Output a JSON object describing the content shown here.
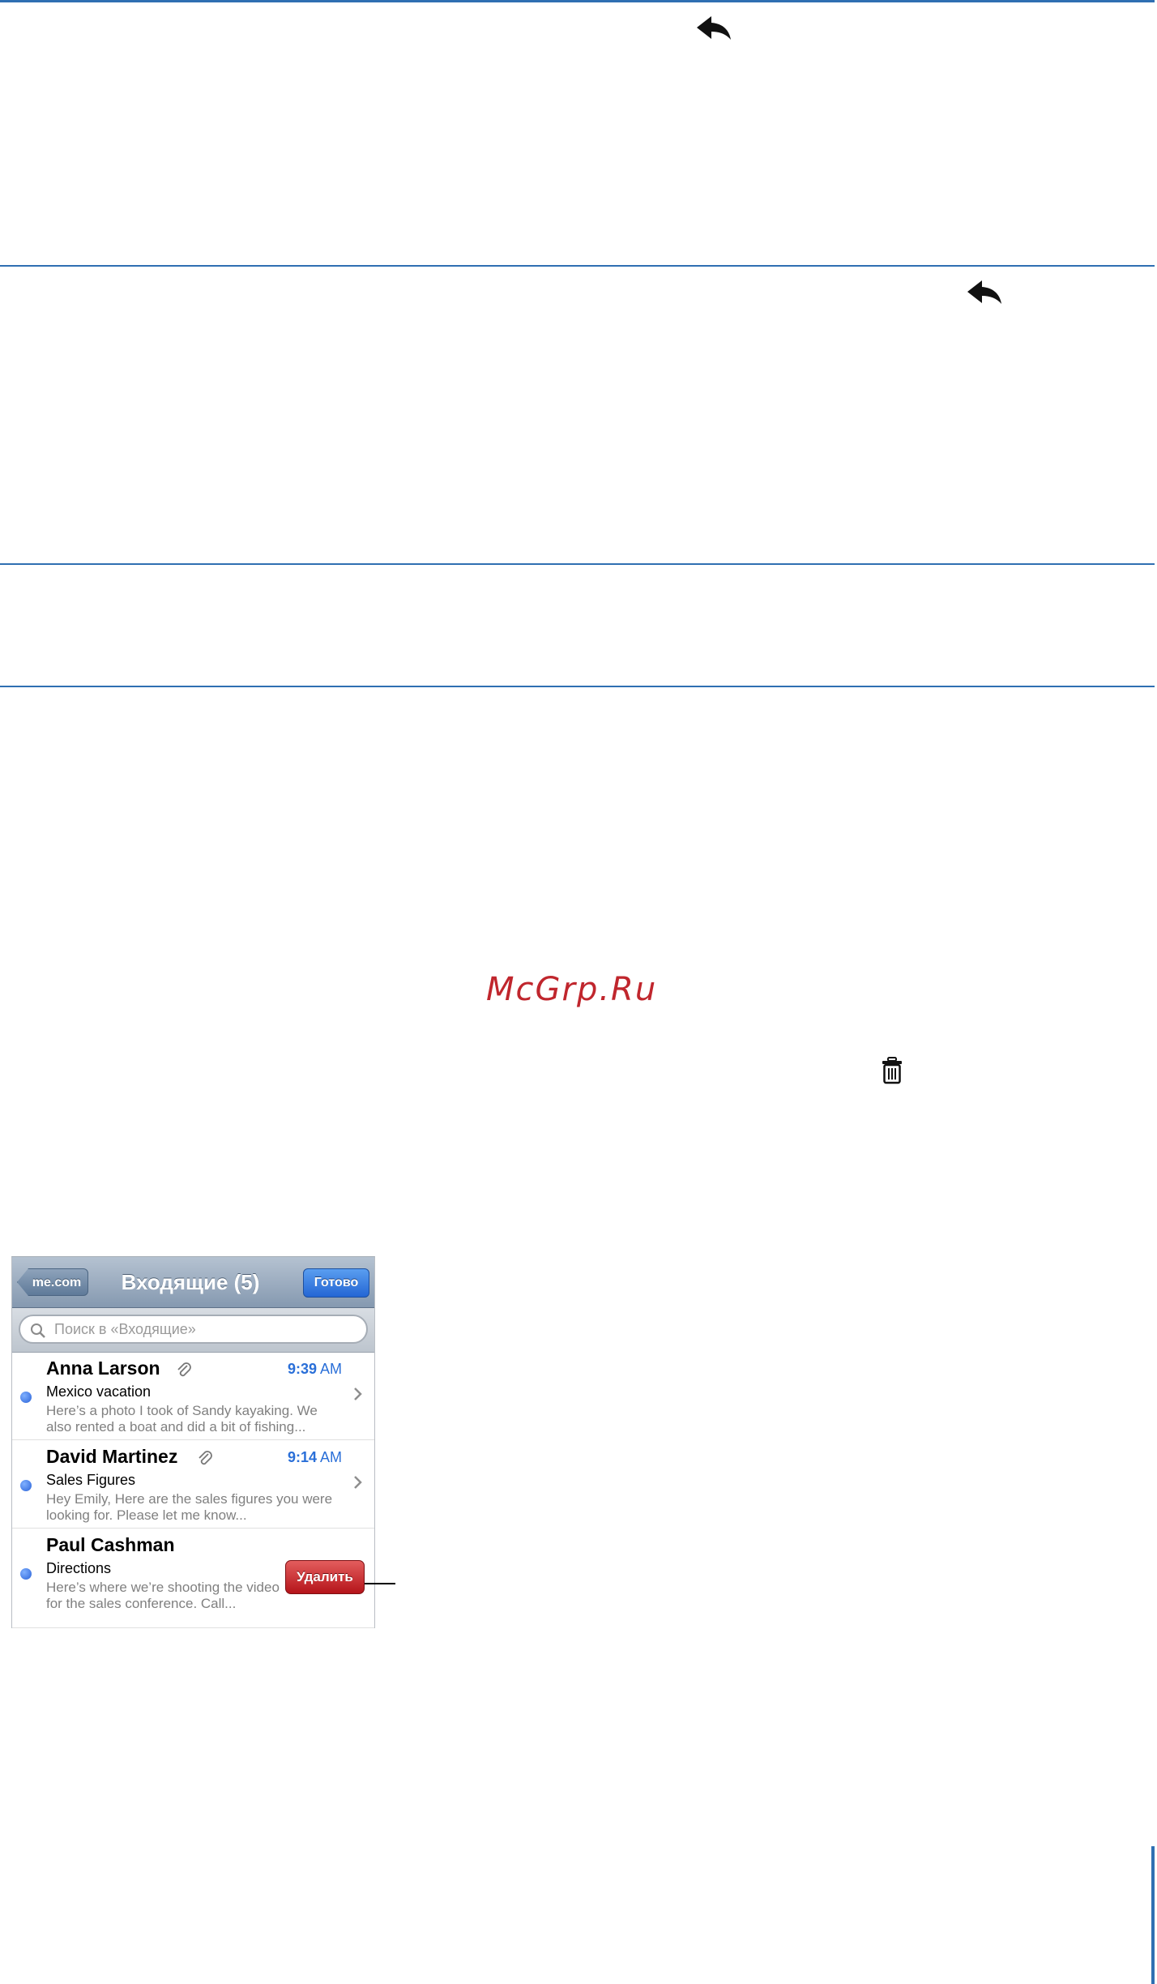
{
  "watermark": "McGrp.Ru",
  "icons": {
    "reply_1": "reply-arrow-icon",
    "reply_2": "reply-arrow-icon",
    "trash": "trash-icon"
  },
  "colors": {
    "rule": "#2f6fb2",
    "watermark": "#c0262d",
    "time": "#2a6fd8",
    "delete": "#c0262d"
  },
  "phone": {
    "nav": {
      "back_label": "me.com",
      "title": "Входящие (5)",
      "done_label": "Готово"
    },
    "search": {
      "placeholder": "Поиск в «Входящие»"
    },
    "messages": [
      {
        "sender": "Anna Larson",
        "attachment": true,
        "time": "9:39",
        "ampm": "AM",
        "subject": "Mexico vacation",
        "preview": "Here’s a photo I took of Sandy kayaking. We also rented a boat and did a bit of fishing..."
      },
      {
        "sender": "David Martinez",
        "attachment": true,
        "time": "9:14",
        "ampm": "AM",
        "subject": "Sales Figures",
        "preview": "Hey Emily, Here are the sales figures you were looking for. Please let me know..."
      },
      {
        "sender": "Paul Cashman",
        "attachment": false,
        "time": "",
        "ampm": "",
        "subject": "Directions",
        "preview": "Here’s where we’re shooting the video for the sales conference. Call..."
      }
    ],
    "delete_label": "Удалить"
  }
}
